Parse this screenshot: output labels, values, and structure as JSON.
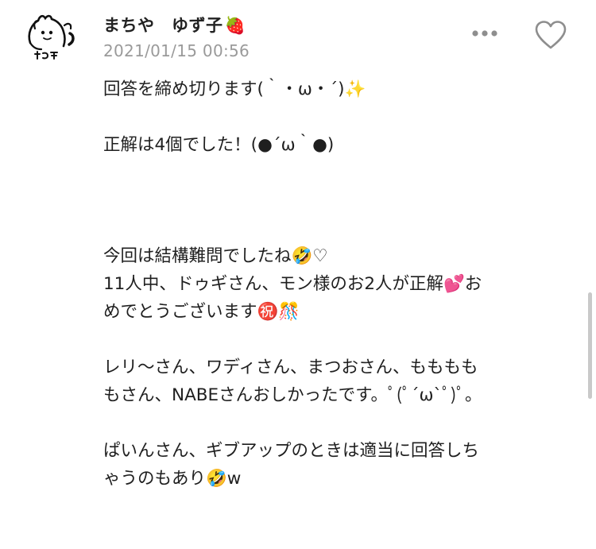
{
  "post": {
    "author": {
      "name": "まちや　ゆず子",
      "badge_emoji": "🍓"
    },
    "timestamp": "2021/01/15 00:56",
    "body_lines": [
      "回答を締め切ります(｀・ω・´)✨",
      "",
      "正解は4個でした！(●´ω｀●)",
      "",
      "",
      "",
      "今回は結構難問でしたね🤣♡",
      "11人中、ドゥギさん、モン様のお2人が正解💕お",
      "めでとうございます㊗️🎊",
      "",
      "レリ〜さん、ワディさん、まつおさん、もももも",
      "もさん、NABEさんおしかったです。ﾟ(ﾟ´ω`ﾟ)ﾟ。",
      "",
      "ぱいんさん、ギブアップのときは適当に回答しち",
      "ゃうのもあり🤣w"
    ]
  },
  "icons": {
    "avatar": "avatar-illustration",
    "more": "more-dots-icon",
    "like": "heart-outline-icon"
  },
  "colors": {
    "text": "#222222",
    "timestamp": "#9a9a9a",
    "icon": "#8e8e8e",
    "background": "#ffffff"
  }
}
